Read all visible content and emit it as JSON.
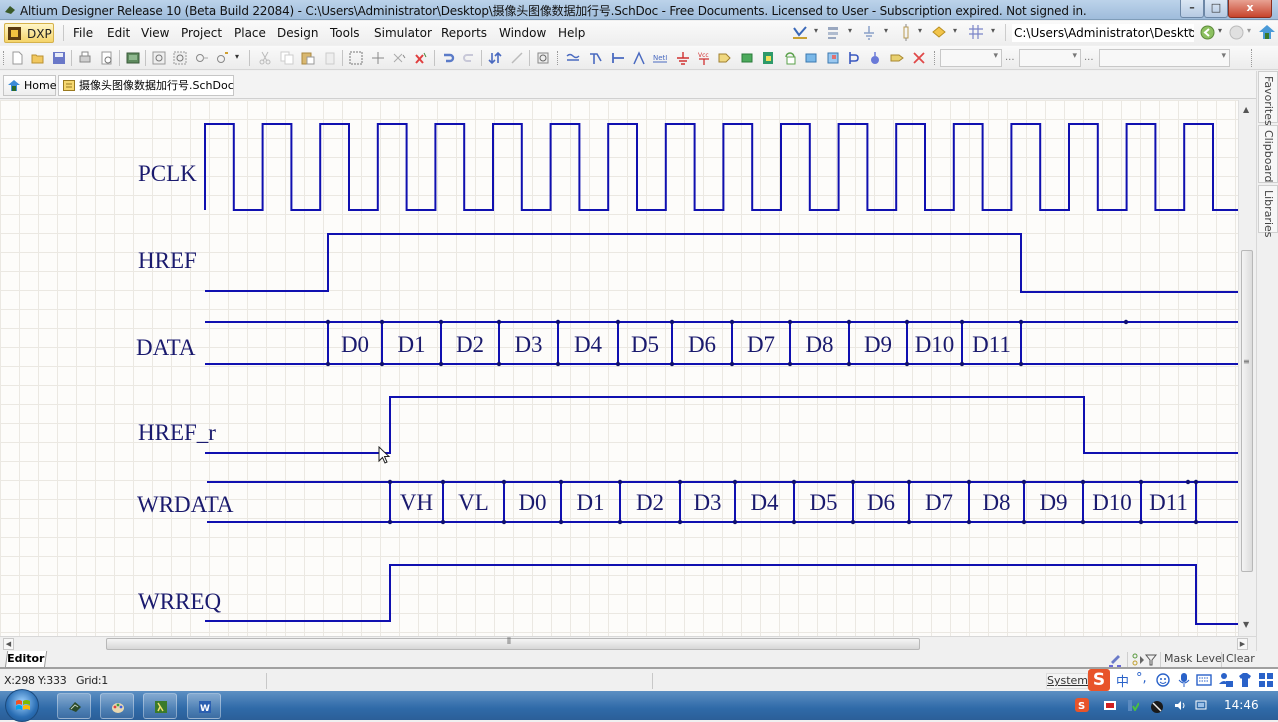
{
  "window": {
    "title": "Altium Designer Release 10 (Beta Build 22084) - C:\\Users\\Administrator\\Desktop\\摄像头图像数据加行号.SchDoc - Free Documents. Licensed to User - Subscription expired. Not signed in.",
    "controls": {
      "minimize": "–",
      "maximize": "□",
      "close": "x"
    }
  },
  "menubar": {
    "dxp_label": "DXP",
    "items": [
      "File",
      "Edit",
      "View",
      "Project",
      "Place",
      "Design",
      "Tools",
      "Simulator",
      "Reports",
      "Window",
      "Help"
    ],
    "path_value": "C:\\Users\\Administrator\\Deskto|"
  },
  "toolbar": {
    "icons": [
      "new-document",
      "open-folder",
      "save",
      "print",
      "print-preview",
      "board-view",
      "zoom-fit",
      "zoom-area",
      "zoom-selected",
      "zoom-filter",
      "cut",
      "copy",
      "paste",
      "rubber-stamp",
      "select-area",
      "move",
      "deselect",
      "clear-filter",
      "undo",
      "redo",
      "hierarchy",
      "cross-probe",
      "browse-component",
      "wire",
      "bus",
      "bus-entry",
      "net-label",
      "gnd-port",
      "vcc-port",
      "place-part",
      "sheet-symbol",
      "sheet-entry",
      "device-sheet",
      "harness",
      "harness-connector",
      "harness-entry",
      "port",
      "no-erc",
      "directive"
    ],
    "combos": [
      "",
      "",
      ""
    ],
    "dots": "..."
  },
  "doc_tabs": [
    {
      "label": "Home",
      "icon": "home-icon"
    },
    {
      "label": "摄像头图像数据加行号.SchDoc",
      "icon": "schematic-doc-icon"
    }
  ],
  "side_panels": [
    "Favorites",
    "Clipboard",
    "Libraries"
  ],
  "timing": {
    "signals": [
      "PCLK",
      "HREF",
      "DATA",
      "HREF_r",
      "WRDATA",
      "WRREQ"
    ],
    "data_cells": [
      "D0",
      "D1",
      "D2",
      "D3",
      "D4",
      "D5",
      "D6",
      "D7",
      "D8",
      "D9",
      "D10",
      "D11"
    ],
    "wrdata_cells": [
      "VH",
      "VL",
      "D0",
      "D1",
      "D2",
      "D3",
      "D4",
      "D5",
      "D6",
      "D7",
      "D8",
      "D9",
      "D10",
      "D11"
    ],
    "pclk_cycles": 18,
    "line_color": "#1010b0",
    "label_color": "#1a1a6e"
  },
  "bottom": {
    "editor_tab": "Editor",
    "mask_level": "Mask Level",
    "clear": "Clear",
    "coords": "X:298 Y:333",
    "grid": "Grid:1",
    "system": "System",
    "ime": {
      "logo": "S",
      "lang": "中",
      "punct": "°,"
    }
  },
  "taskbar": {
    "apps": [
      "altium-icon",
      "paint-icon",
      "terminal-icon",
      "word-icon"
    ],
    "clock": "14:46"
  }
}
